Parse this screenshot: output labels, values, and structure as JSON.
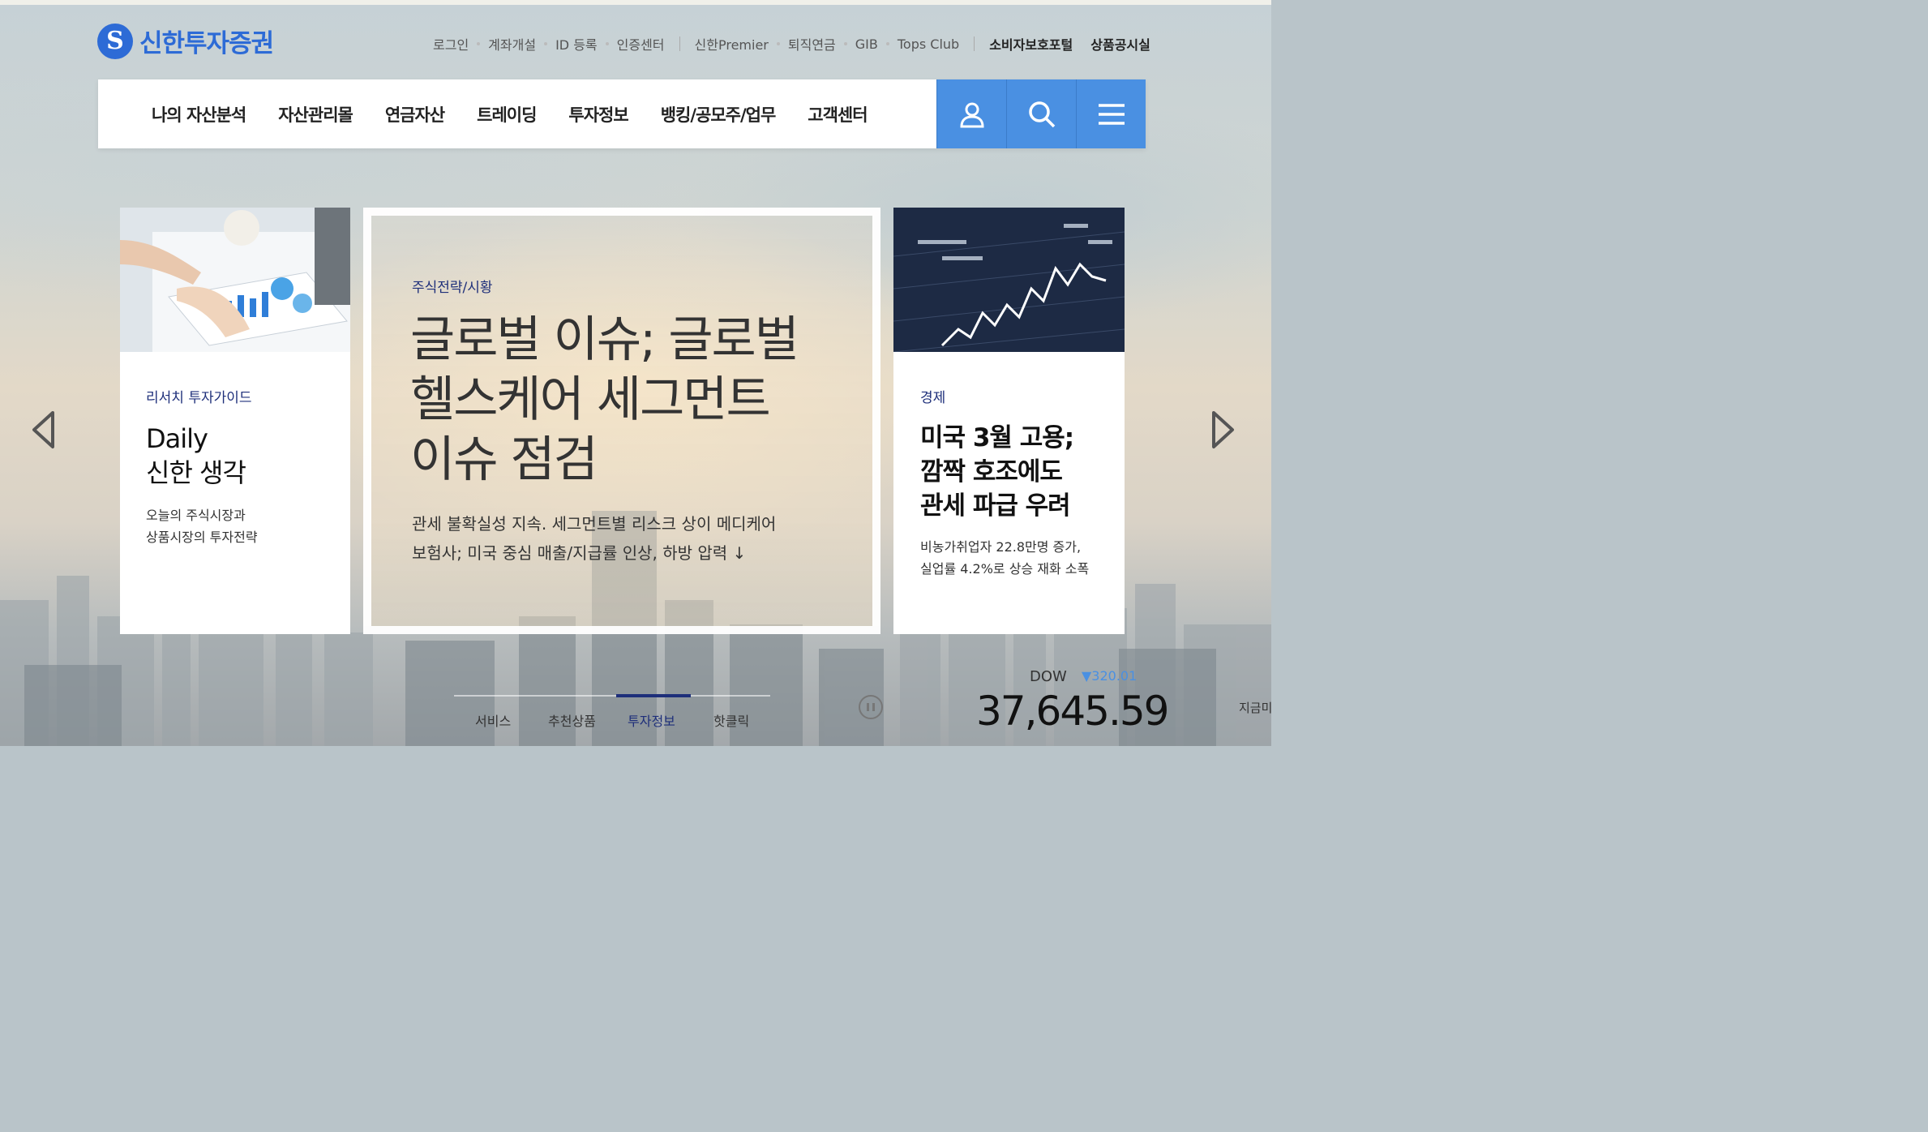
{
  "brand": {
    "name": "신한투자증권",
    "mark": "S",
    "color": "#2d6bd6"
  },
  "util_links": [
    "로그인",
    "계좌개설",
    "ID 등록",
    "인증센터"
  ],
  "util_links2": [
    "신한Premier",
    "퇴직연금",
    "GIB",
    "Tops Club"
  ],
  "util_strong": [
    "소비자보호포털",
    "상품공시실"
  ],
  "nav": {
    "items": [
      "나의 자산분석",
      "자산관리몰",
      "연금자산",
      "트레이딩",
      "투자정보",
      "뱅킹/공모주/업무",
      "고객센터"
    ],
    "buttons": [
      "user-icon",
      "search-icon",
      "menu-icon"
    ],
    "accent": "#4a90e2"
  },
  "cards": {
    "left": {
      "category": "리서치 투자가이드",
      "title_line1": "Daily",
      "title_line2": "신한 생각",
      "desc_line1": "오늘의 주식시장과",
      "desc_line2": "상품시장의 투자전략"
    },
    "center": {
      "category": "주식전략/시황",
      "title_line1": "글로벌 이슈; 글로벌",
      "title_line2": "헬스케어 세그먼트",
      "title_line3": "이슈 점검",
      "desc_line1": "관세 불확실성 지속. 세그먼트별 리스크 상이 메디케어",
      "desc_line2": "보험사; 미국 중심 매출/지급률 인상, 하방 압력 ↓"
    },
    "right": {
      "category": "경제",
      "title_line1": "미국 3월 고용;",
      "title_line2": "깜짝 호조에도",
      "title_line3": "관세 파급 우려",
      "desc_line1": "비농가취업자 22.8만명 증가,",
      "desc_line2": "실업률 4.2%로 상승 재화 소폭"
    }
  },
  "tabs": {
    "items": [
      "서비스",
      "추천상품",
      "투자정보",
      "핫클릭"
    ],
    "active": "투자정보"
  },
  "ticker": {
    "name": "DOW",
    "change": "▼320.01",
    "value": "37,645.59"
  },
  "edge_text": "지금미"
}
